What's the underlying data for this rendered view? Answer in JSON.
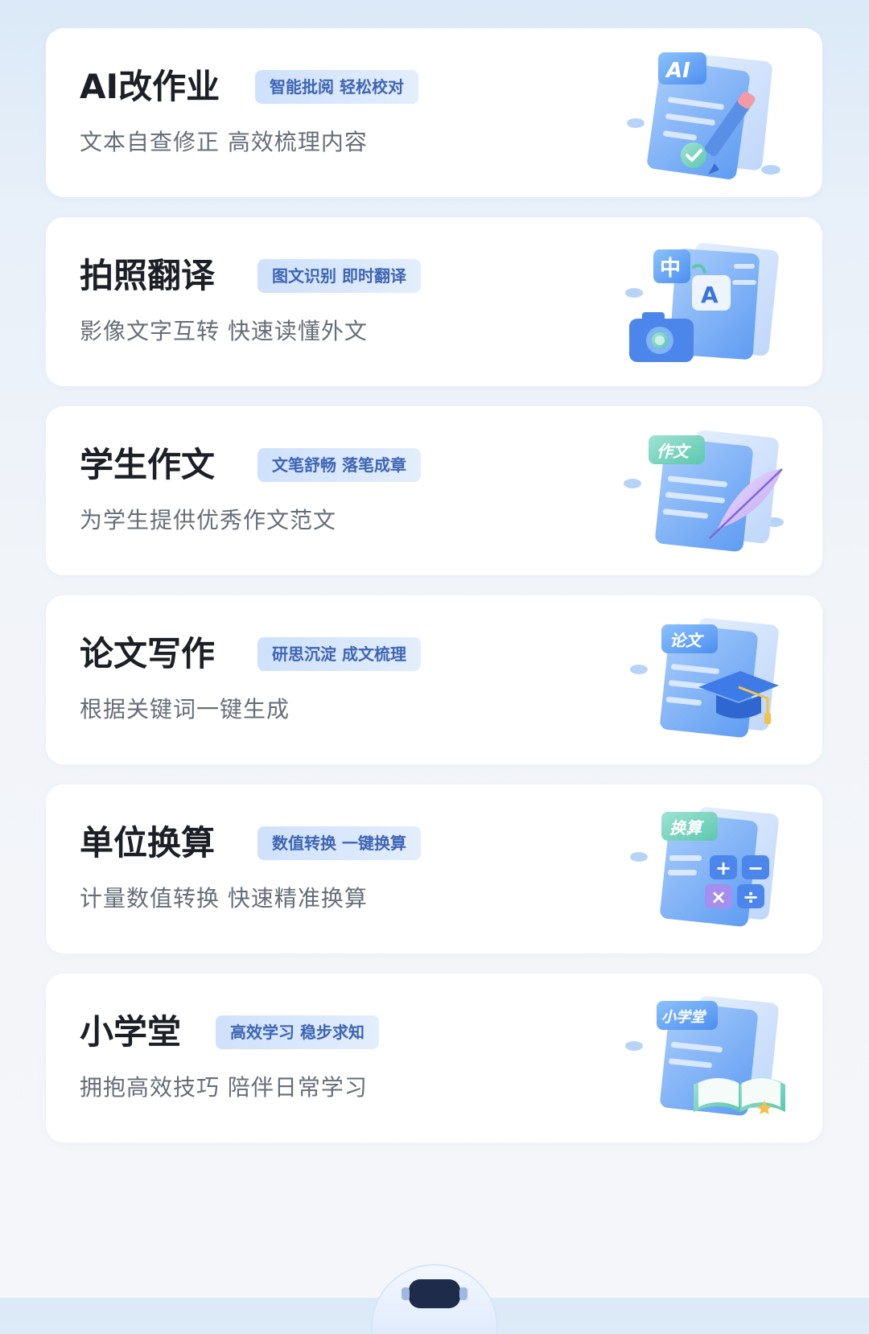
{
  "cards": [
    {
      "title": "AI改作业",
      "tag": "智能批阅 轻松校对",
      "desc": "文本自查修正 高效梳理内容",
      "badge": "AI",
      "icon": "ai-homework-icon"
    },
    {
      "title": "拍照翻译",
      "tag": "图文识别 即时翻译",
      "desc": "影像文字互转 快速读懂外文",
      "badge_zh": "中",
      "badge_en": "A",
      "icon": "photo-translate-icon"
    },
    {
      "title": "学生作文",
      "tag": "文笔舒畅 落笔成章",
      "desc": "为学生提供优秀作文范文",
      "badge": "作文",
      "icon": "essay-icon"
    },
    {
      "title": "论文写作",
      "tag": "研思沉淀 成文梳理",
      "desc": "根据关键词一键生成",
      "badge": "论文",
      "icon": "thesis-icon"
    },
    {
      "title": "单位换算",
      "tag": "数值转换 一键换算",
      "desc": "计量数值转换 快速精准换算",
      "badge": "换算",
      "ops": [
        "+",
        "−",
        "×",
        "÷"
      ],
      "icon": "unit-convert-icon"
    },
    {
      "title": "小学堂",
      "tag": "高效学习 稳步求知",
      "desc": "拥抱高效技巧 陪伴日常学习",
      "badge": "小学堂",
      "icon": "classroom-icon"
    }
  ],
  "colors": {
    "tag_text": "#3f65b3",
    "tag_bg": "#d7e6fb",
    "illustration_blue": "#6ea6f5",
    "title": "#1c1f26",
    "desc": "#676d78"
  },
  "robot_icon": "robot-assistant-icon"
}
